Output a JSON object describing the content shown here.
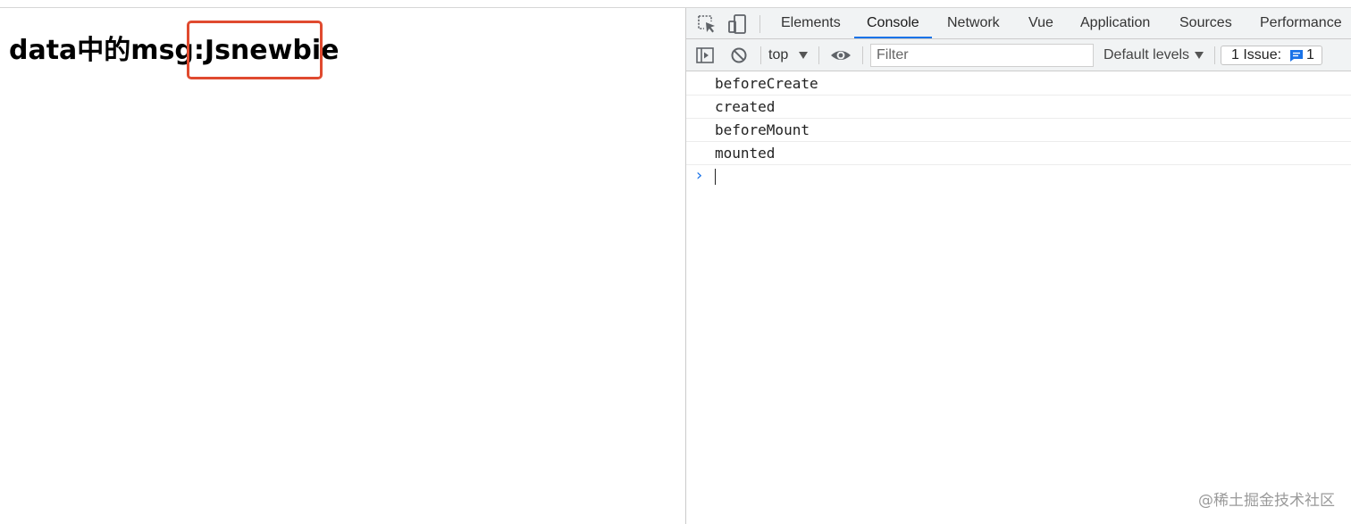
{
  "page": {
    "heading_prefix": "data中的msg:",
    "heading_value": "Jsnewbie"
  },
  "devtools": {
    "tabs": [
      {
        "label": "Elements",
        "active": false
      },
      {
        "label": "Console",
        "active": true
      },
      {
        "label": "Network",
        "active": false
      },
      {
        "label": "Vue",
        "active": false
      },
      {
        "label": "Application",
        "active": false
      },
      {
        "label": "Sources",
        "active": false
      },
      {
        "label": "Performance",
        "active": false
      }
    ],
    "toolbar": {
      "context": "top",
      "filter_placeholder": "Filter",
      "levels": "Default levels",
      "issues_label": "1 Issue:",
      "issues_count": "1"
    },
    "console_logs": [
      "beforeCreate",
      "created",
      "beforeMount",
      "mounted"
    ],
    "prompt_symbol": "›"
  },
  "watermark": "@稀土掘金技术社区",
  "colors": {
    "highlight_border": "#e04a2f",
    "active_tab_underline": "#1a73e8",
    "toolbar_bg": "#f1f3f4",
    "prompt": "#1a73e8"
  }
}
